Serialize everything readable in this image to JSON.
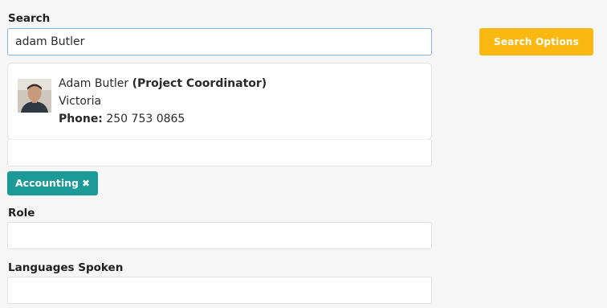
{
  "search": {
    "label": "Search",
    "value": "adam Butler",
    "options_button": "Search Options"
  },
  "result": {
    "name": "Adam Butler",
    "title": "(Project Coordinator)",
    "location": "Victoria",
    "phone_label": "Phone:",
    "phone": "250 753 0865"
  },
  "filter": {
    "tag_label": "Accounting",
    "tag_close": "✖"
  },
  "role": {
    "label": "Role",
    "value": ""
  },
  "languages": {
    "label": "Languages Spoken",
    "value": ""
  },
  "icons": {
    "avatar": "person-photo",
    "tag_remove": "close-icon"
  },
  "colors": {
    "accent_orange": "#fbb811",
    "tag_teal": "#1c9a98",
    "input_focus_border": "#88b3dc"
  }
}
